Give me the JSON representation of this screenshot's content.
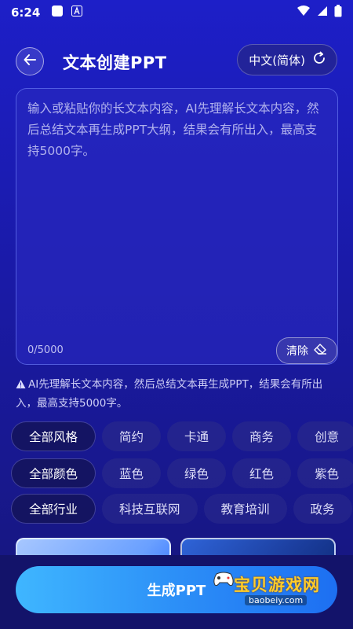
{
  "status_bar": {
    "time": "6:24"
  },
  "header": {
    "title": "文本创建PPT",
    "language": "中文(简体)"
  },
  "editor": {
    "placeholder": "输入或粘贴你的长文本内容，AI先理解长文本内容，然后总结文本再生成PPT大纲，结果会有所出入，最高支持5000字。",
    "value": "",
    "char_count": "0/5000",
    "clear_label": "清除"
  },
  "hint": "AI先理解长文本内容，然后总结文本再生成PPT，结果会有所出入，最高支持5000字。",
  "filters": {
    "style": [
      "全部风格",
      "简约",
      "卡通",
      "商务",
      "创意"
    ],
    "color": [
      "全部颜色",
      "蓝色",
      "绿色",
      "红色",
      "紫色"
    ],
    "industry": [
      "全部行业",
      "科技互联网",
      "教育培训",
      "政务"
    ]
  },
  "actions": {
    "generate_label": "生成PPT"
  },
  "watermark": {
    "logo_text": "宝贝游戏网",
    "url": "baobeiy.com"
  },
  "colors": {
    "accent": "#2c8ff7",
    "background": "#1d1fc8",
    "watermark": "#ffcc2a"
  },
  "icons": {
    "back": "arrow-left-icon",
    "language": "refresh-icon",
    "clear": "eraser-icon",
    "hint": "warning-icon"
  }
}
